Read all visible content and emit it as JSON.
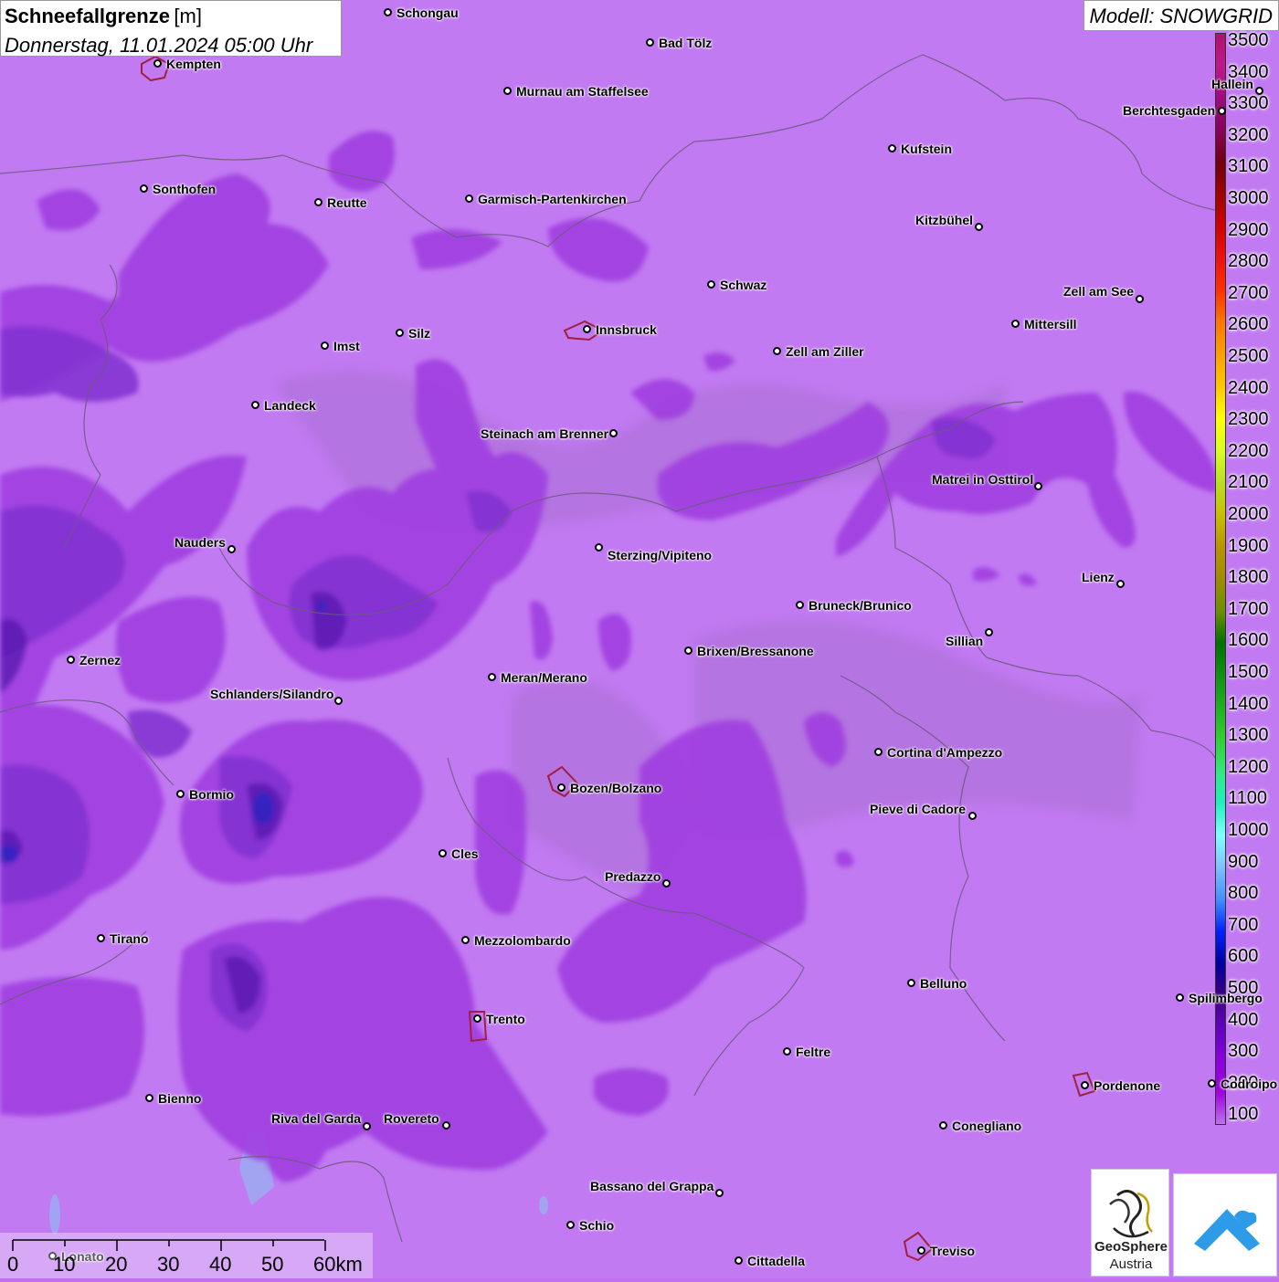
{
  "title": {
    "main": "Schneefallgrenze",
    "unit": "[m]",
    "datetime": "Donnerstag, 11.01.2024 05:00 Uhr"
  },
  "model": "Modell: SNOWGRID",
  "legend": {
    "labels": [
      "3500",
      "3400",
      "3300",
      "3200",
      "3100",
      "3000",
      "2900",
      "2800",
      "2700",
      "2600",
      "2500",
      "2400",
      "2300",
      "2200",
      "2100",
      "2000",
      "1900",
      "1800",
      "1700",
      "1600",
      "1500",
      "1400",
      "1300",
      "1200",
      "1100",
      "1000",
      "900",
      "800",
      "700",
      "600",
      "500",
      "400",
      "300",
      "200",
      "100"
    ],
    "colors": [
      "#b0106e",
      "#c0188a",
      "#a00a80",
      "#8a005a",
      "#700010",
      "#a00000",
      "#d00000",
      "#f01010",
      "#ff3000",
      "#ff7800",
      "#ffa000",
      "#ffc800",
      "#ffff00",
      "#d8ff20",
      "#b8e020",
      "#c8c000",
      "#b89400",
      "#a08c00",
      "#6c9000",
      "#007000",
      "#109010",
      "#20b020",
      "#30d030",
      "#30e880",
      "#20f0c0",
      "#80ffff",
      "#80c0ff",
      "#4090ff",
      "#0020ff",
      "#0000a0",
      "#400080",
      "#6000c0",
      "#8a00e0",
      "#a000e0",
      "#c070f0"
    ]
  },
  "cities": [
    {
      "name": "Schongau"
    },
    {
      "name": "Bad Tölz"
    },
    {
      "name": "Kempten"
    },
    {
      "name": "Murnau am Staffelsee"
    },
    {
      "name": "Hallein"
    },
    {
      "name": "Berchtesgaden"
    },
    {
      "name": "Kufstein"
    },
    {
      "name": "Sonthofen"
    },
    {
      "name": "Reutte"
    },
    {
      "name": "Garmisch-Partenkirchen"
    },
    {
      "name": "Kitzbühel"
    },
    {
      "name": "Schwaz"
    },
    {
      "name": "Zell am See"
    },
    {
      "name": "Innsbruck"
    },
    {
      "name": "Silz"
    },
    {
      "name": "Mittersill"
    },
    {
      "name": "Imst"
    },
    {
      "name": "Zell am Ziller"
    },
    {
      "name": "Landeck"
    },
    {
      "name": "Steinach am Brenner"
    },
    {
      "name": "Matrei in Osttirol"
    },
    {
      "name": "Nauders"
    },
    {
      "name": "Sterzing/Vipiteno"
    },
    {
      "name": "Lienz"
    },
    {
      "name": "Bruneck/Brunico"
    },
    {
      "name": "Sillian"
    },
    {
      "name": "Brixen/Bressanone"
    },
    {
      "name": "Zernez"
    },
    {
      "name": "Meran/Merano"
    },
    {
      "name": "Schlanders/Silandro"
    },
    {
      "name": "Cortina d'Ampezzo"
    },
    {
      "name": "Bozen/Bolzano"
    },
    {
      "name": "Bormio"
    },
    {
      "name": "Pieve di Cadore"
    },
    {
      "name": "Cles"
    },
    {
      "name": "Predazzo"
    },
    {
      "name": "Tirano"
    },
    {
      "name": "Mezzolombardo"
    },
    {
      "name": "Belluno"
    },
    {
      "name": "Spilimbergo"
    },
    {
      "name": "Trento"
    },
    {
      "name": "Feltre"
    },
    {
      "name": "Pordenone"
    },
    {
      "name": "Codroipo"
    },
    {
      "name": "Bienno"
    },
    {
      "name": "Riva del Garda"
    },
    {
      "name": "Rovereto"
    },
    {
      "name": "Conegliano"
    },
    {
      "name": "Bassano del Grappa"
    },
    {
      "name": "Schio"
    },
    {
      "name": "Treviso"
    },
    {
      "name": "Lonato"
    },
    {
      "name": "Cittadella"
    }
  ],
  "scale": {
    "labels": [
      "0",
      "10",
      "20",
      "30",
      "40",
      "50",
      "60km"
    ]
  },
  "logos": {
    "geosphere_line1": "GeoSphere",
    "geosphere_line2": "Austria"
  }
}
